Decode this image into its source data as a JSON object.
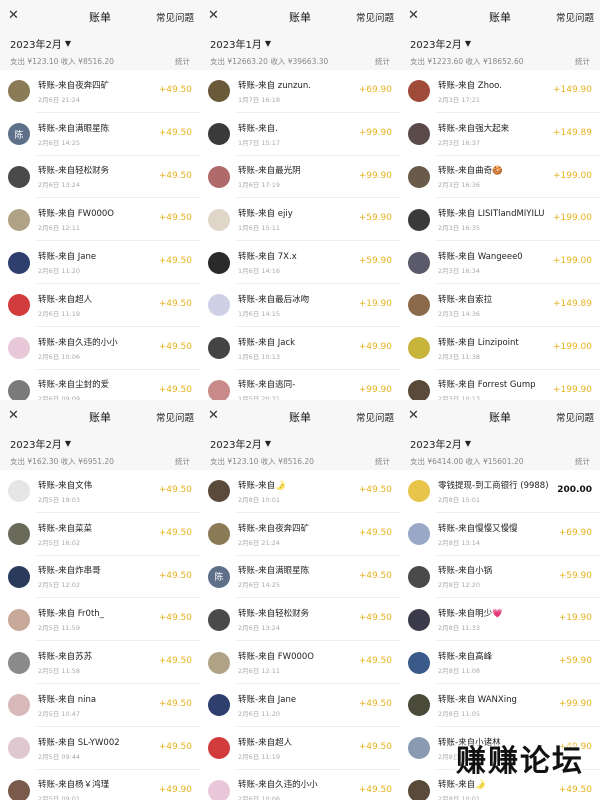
{
  "colors": {
    "income": "#e6b21e",
    "header_bg": "#f7f7f7"
  },
  "header": {
    "close_icon": "close-icon",
    "title": "账单",
    "faq": "常见问题"
  },
  "stat_label": "统计",
  "panels": [
    {
      "month": "2023年2月",
      "summary": "支出 ¥123.10 收入 ¥8516.20",
      "items": [
        {
          "name": "转账-来自夜奔四矿",
          "time": "2月6日 21:24",
          "amount": "+49.50",
          "avatar": "#8a7a56"
        },
        {
          "name": "转账-来自满眼星陈",
          "time": "2月6日 14:25",
          "amount": "+49.50",
          "avatar": "#5d6f89",
          "glyph": "陈"
        },
        {
          "name": "转账-来自轻松财务",
          "time": "2月6日 13:24",
          "amount": "+49.50",
          "avatar": "#4a4a4a"
        },
        {
          "name": "转账-来自 FW000O",
          "time": "2月6日 12:11",
          "amount": "+49.50",
          "avatar": "#b0a285"
        },
        {
          "name": "转账-来自 Jane",
          "time": "2月6日 11:20",
          "amount": "+49.50",
          "avatar": "#2e3e6e"
        },
        {
          "name": "转账-来自超人",
          "time": "2月6日 11:19",
          "amount": "+49.50",
          "avatar": "#d23c3c"
        },
        {
          "name": "转账-来自久违的小小",
          "time": "2月6日 10:06",
          "amount": "+49.50",
          "avatar": "#e8c8d8"
        },
        {
          "name": "转账-来自尘封的爱",
          "time": "2月6日 09:09",
          "amount": "+49.50",
          "avatar": "#7a7a7a"
        }
      ]
    },
    {
      "month": "2023年1月",
      "summary": "支出 ¥12663.20 收入 ¥39663.30",
      "items": [
        {
          "name": "转账-来自 zunzun.",
          "time": "1月7日 16:18",
          "amount": "+69.90",
          "avatar": "#6b5a3a"
        },
        {
          "name": "转账-来自.",
          "time": "1月7日 15:17",
          "amount": "+99.90",
          "avatar": "#3a3a3a"
        },
        {
          "name": "转账-来自最光阴",
          "time": "1月6日 17:19",
          "amount": "+99.90",
          "avatar": "#b06a6a"
        },
        {
          "name": "转账-来自 ejiy",
          "time": "1月6日 15:11",
          "amount": "+59.90",
          "avatar": "#e0d6c8"
        },
        {
          "name": "转账-来自 7X.x",
          "time": "1月6日 14:16",
          "amount": "+59.90",
          "avatar": "#2a2a2a"
        },
        {
          "name": "转账-来自最后冰吻",
          "time": "1月6日 14:15",
          "amount": "+19.90",
          "avatar": "#cfcfe6"
        },
        {
          "name": "转账-来自 Jack",
          "time": "1月6日 10:13",
          "amount": "+49.90",
          "avatar": "#444444"
        },
        {
          "name": "转账-来自逃同-",
          "time": "1月5日 20:31",
          "amount": "+99.90",
          "avatar": "#c98a8a"
        }
      ]
    },
    {
      "month": "2023年2月",
      "summary": "支出 ¥1223.60 收入 ¥18652.60",
      "items": [
        {
          "name": "转账-来自 Zhoo.",
          "time": "2月3日 17:21",
          "amount": "+149.90",
          "avatar": "#a04a3a"
        },
        {
          "name": "转账-来自强大起来",
          "time": "2月3日 16:37",
          "amount": "+149.89",
          "avatar": "#5a4a4a"
        },
        {
          "name": "转账-来自曲奇🍪",
          "time": "2月3日 16:36",
          "amount": "+199.00",
          "avatar": "#6a5a4a"
        },
        {
          "name": "转账-来自 LISITlandMIYILU",
          "time": "2月3日 16:35",
          "amount": "+199.00",
          "avatar": "#3a3a3a"
        },
        {
          "name": "转账-来自 Wangeee0",
          "time": "2月3日 16:34",
          "amount": "+199.00",
          "avatar": "#5a5a6a"
        },
        {
          "name": "转账-来自索拉",
          "time": "2月3日 14:36",
          "amount": "+149.89",
          "avatar": "#8a6a4a"
        },
        {
          "name": "转账-来自 Linzipoint",
          "time": "2月3日 11:38",
          "amount": "+199.00",
          "avatar": "#c8b43a"
        },
        {
          "name": "转账-来自 Forrest Gump",
          "time": "2月3日 10:13",
          "amount": "+199.90",
          "avatar": "#5a4a3a"
        }
      ]
    },
    {
      "month": "2023年2月",
      "summary": "支出 ¥162.30 收入 ¥6951.20",
      "items": [
        {
          "name": "转账-来自文伟",
          "time": "2月5日 19:03",
          "amount": "+49.50",
          "avatar": "#e6e6e6"
        },
        {
          "name": "转账-来自菜菜",
          "time": "2月5日 16:02",
          "amount": "+49.50",
          "avatar": "#6a6a5a"
        },
        {
          "name": "转账-来自炸串哥",
          "time": "2月5日 12:02",
          "amount": "+49.50",
          "avatar": "#2a3a5a"
        },
        {
          "name": "转账-来自 Fr0th_",
          "time": "2月5日 11:59",
          "amount": "+49.50",
          "avatar": "#c8a898"
        },
        {
          "name": "转账-来自苏苏",
          "time": "2月5日 11:58",
          "amount": "+49.50",
          "avatar": "#8a8a8a"
        },
        {
          "name": "转账-来自 nina",
          "time": "2月5日 10:47",
          "amount": "+49.50",
          "avatar": "#d8b8b8"
        },
        {
          "name": "转账-来自 SL-YW002",
          "time": "2月5日 09:44",
          "amount": "+49.50",
          "avatar": "#e0c8d0"
        },
        {
          "name": "转账-来自杨￥鸿瑾",
          "time": "2月5日 09:01",
          "amount": "+49.90",
          "avatar": "#7a5a4a"
        }
      ]
    },
    {
      "month": "2023年2月",
      "summary": "支出 ¥123.10 收入 ¥8516.20",
      "items": [
        {
          "name": "转账-来自🌛",
          "time": "2月8日 10:01",
          "amount": "+49.50",
          "avatar": "#5a4a3a"
        },
        {
          "name": "转账-来自夜奔四矿",
          "time": "2月6日 21:24",
          "amount": "+49.50",
          "avatar": "#8a7a56"
        },
        {
          "name": "转账-来自满眼星陈",
          "time": "2月6日 14:25",
          "amount": "+49.50",
          "avatar": "#5d6f89",
          "glyph": "陈"
        },
        {
          "name": "转账-来自轻松财务",
          "time": "2月6日 13:24",
          "amount": "+49.50",
          "avatar": "#4a4a4a"
        },
        {
          "name": "转账-来自 FW000O",
          "time": "2月6日 12:11",
          "amount": "+49.50",
          "avatar": "#b0a285"
        },
        {
          "name": "转账-来自 Jane",
          "time": "2月6日 11:20",
          "amount": "+49.50",
          "avatar": "#2e3e6e"
        },
        {
          "name": "转账-来自超人",
          "time": "2月6日 11:19",
          "amount": "+49.50",
          "avatar": "#d23c3c"
        },
        {
          "name": "转账-来自久违的小小",
          "time": "2月6日 10:06",
          "amount": "+49.50",
          "avatar": "#e8c8d8"
        }
      ]
    },
    {
      "month": "2023年2月",
      "summary": "支出 ¥6414.00 收入 ¥15601.20",
      "items": [
        {
          "name": "零钱提现-到工商银行 (9988)",
          "time": "2月8日 15:01",
          "amount": "200.00",
          "avatar": "#e8c44a",
          "neg": true
        },
        {
          "name": "转账-来自慢慢又慢慢",
          "time": "2月8日 13:14",
          "amount": "+69.90",
          "avatar": "#9aa8c8"
        },
        {
          "name": "转账-来自小锅",
          "time": "2月8日 12:20",
          "amount": "+59.90",
          "avatar": "#4a4a4a"
        },
        {
          "name": "转账-来自明少💗",
          "time": "2月8日 11:33",
          "amount": "+19.90",
          "avatar": "#3a3a4a"
        },
        {
          "name": "转账-来自高峰",
          "time": "2月8日 11:08",
          "amount": "+59.90",
          "avatar": "#3a5a8a"
        },
        {
          "name": "转账-来自 WANXing",
          "time": "2月8日 11:05",
          "amount": "+99.90",
          "avatar": "#4a4a3a"
        },
        {
          "name": "转账-来自小诸林",
          "time": "2月8日 10:55",
          "amount": "+49.90",
          "avatar": "#8a9ab0"
        },
        {
          "name": "转账-来自🌛",
          "time": "2月8日 10:01",
          "amount": "+49.50",
          "avatar": "#5a4a3a"
        }
      ]
    }
  ],
  "watermark": "赚赚论坛"
}
